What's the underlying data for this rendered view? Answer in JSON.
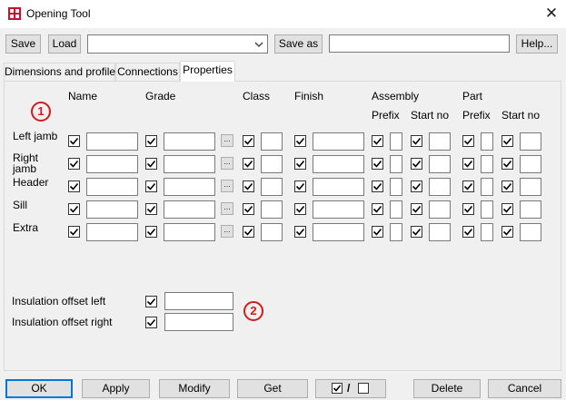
{
  "window": {
    "title": "Opening Tool",
    "close_icon": "close-icon"
  },
  "toolbar": {
    "save_label": "Save",
    "load_label": "Load",
    "preset_value": "",
    "save_as_label": "Save as",
    "save_as_value": "",
    "help_label": "Help..."
  },
  "tabs": [
    {
      "label": "Dimensions and profiles"
    },
    {
      "label": "Connections"
    },
    {
      "label": "Properties"
    }
  ],
  "headers": {
    "name": "Name",
    "grade": "Grade",
    "class": "Class",
    "finish": "Finish",
    "assembly": "Assembly",
    "part": "Part",
    "prefix": "Prefix",
    "start_no": "Start no"
  },
  "rows": [
    {
      "label": "Left jamb"
    },
    {
      "label": "Right jamb"
    },
    {
      "label": "Header"
    },
    {
      "label": "Sill"
    },
    {
      "label": "Extra"
    }
  ],
  "grade_browse_label": "...",
  "insulation": {
    "left_label": "Insulation offset left",
    "left_value": "",
    "right_label": "Insulation offset right",
    "right_value": ""
  },
  "badges": {
    "one": "1",
    "two": "2"
  },
  "footer": {
    "ok_label": "OK",
    "apply_label": "Apply",
    "modify_label": "Modify",
    "get_label": "Get",
    "toggle_separator": "/",
    "delete_label": "Delete",
    "cancel_label": "Cancel"
  },
  "colors": {
    "accent": "#0078d7",
    "badge": "#d41a1a"
  }
}
